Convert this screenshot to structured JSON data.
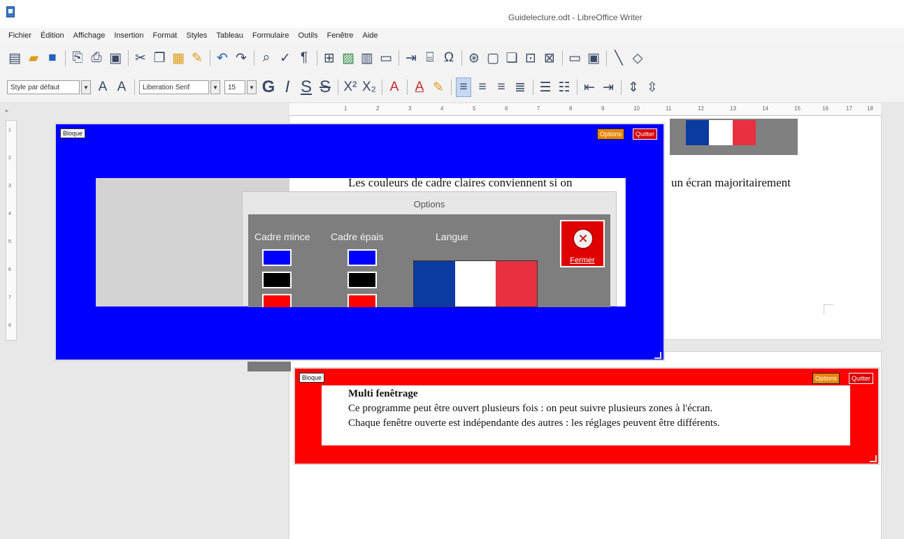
{
  "window": {
    "title": "Guidelecture.odt - LibreOffice Writer"
  },
  "menu": [
    "Fichier",
    "Édition",
    "Affichage",
    "Insertion",
    "Format",
    "Styles",
    "Tableau",
    "Formulaire",
    "Outils",
    "Fenêtre",
    "Aide"
  ],
  "format_toolbar": {
    "paragraph_style": "Style par défaut",
    "font_name": "Liberation Serif",
    "font_size": "15",
    "bold": "G",
    "italic": "I",
    "underline": "S",
    "strike": "S"
  },
  "ruler": {
    "ticks": [
      "1",
      "2",
      "3",
      "4",
      "5",
      "6",
      "7",
      "8",
      "9",
      "10",
      "11",
      "12",
      "13",
      "14",
      "15",
      "16",
      "17",
      "18"
    ]
  },
  "document": {
    "page1_text": "Les couleurs de cadre claires conviennent si on ... un écran majoritairement",
    "page1_text_visible_left": "Les couleurs de cadre claires conviennent si on",
    "page1_text_visible_right": "un écran majoritairement",
    "multi": {
      "title": "Multi fenêtrage",
      "line1": "Ce programme peut être ouvert plusieurs fois : on peut suivre plusieurs zones à l'écran.",
      "line2": "Chaque fenêtre ouverte est indépendante des autres : les réglages peuvent être différents."
    }
  },
  "overlay_blue": {
    "tag": "Bloque",
    "options_label": "Options",
    "quit_label": "Quitter"
  },
  "overlay_red": {
    "tag": "Bloque",
    "options_label": "Options",
    "quit_label": "Quitter"
  },
  "options_dialog": {
    "title": "Options",
    "thin_frame_label": "Cadre mince",
    "thick_frame_label": "Cadre épais",
    "language_label": "Langue",
    "close_label": "Fermer",
    "swatch_colors": [
      "#0000ff",
      "#000000",
      "#ff0000"
    ]
  },
  "colors": {
    "blue_frame": "#0000ff",
    "red_frame": "#ff0000",
    "flag_blue": "#0b3aa0",
    "flag_white": "#ffffff",
    "flag_red": "#e8303e"
  }
}
